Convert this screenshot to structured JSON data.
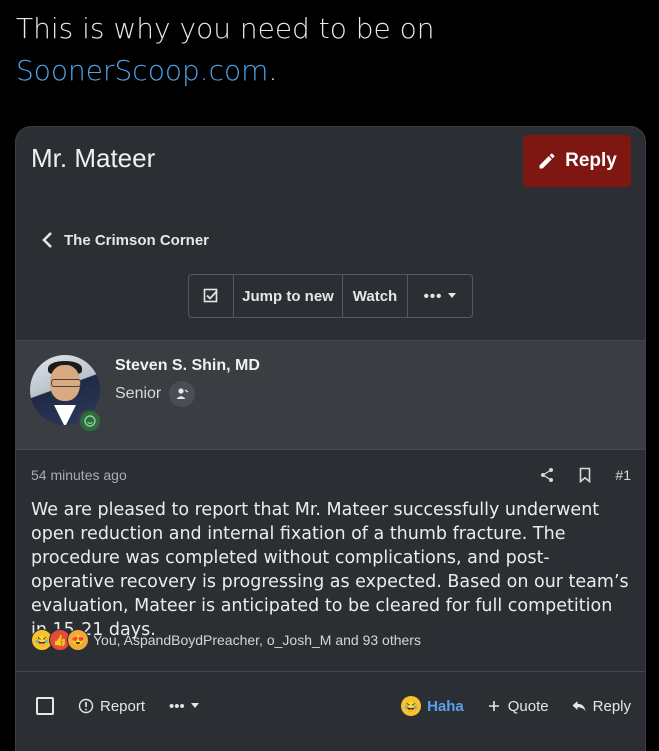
{
  "tweet": {
    "text_before": "This is why you need to be on ",
    "link": "SoonerScoop.com",
    "text_after": "."
  },
  "thread": {
    "title": "Mr. Mateer",
    "reply_label": "Reply",
    "breadcrumb": "The Crimson Corner"
  },
  "toolbar": {
    "jump_label": "Jump to new",
    "watch_label": "Watch",
    "more_label": "•••"
  },
  "post": {
    "author_name": "Steven S. Shin, MD",
    "author_role": "Senior",
    "time": "54 minutes ago",
    "number": "#1",
    "body": "We are pleased to report that Mr. Mateer successfully underwent open reduction and internal fixation of a thumb fracture. The procedure was completed without complications, and post-operative recovery is progressing as expected. Based on our team’s evaluation, Mateer is anticipated to be cleared for full competition in 15-21 days.",
    "reactions_text": "You, AspandBoydPreacher, o_Josh_M and 93 others"
  },
  "actions": {
    "report_label": "Report",
    "more_label": "•••",
    "haha_label": "Haha",
    "quote_label": "Quote",
    "reply_label": "Reply"
  },
  "colors": {
    "reply_button": "#7e1612",
    "link": "#4ea4ee",
    "haha": "#5aa0ef"
  }
}
